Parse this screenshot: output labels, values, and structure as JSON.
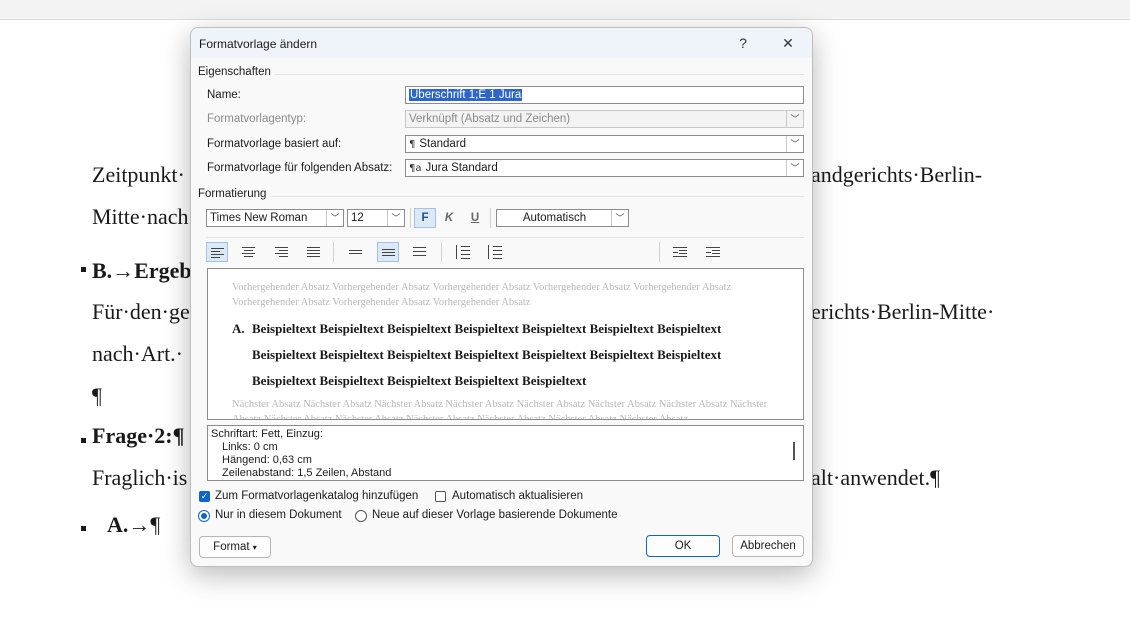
{
  "document": {
    "line1": "Zeitpunkt·",
    "line1_right": "andgerichts·Berlin-",
    "line2": "Mitte·nach",
    "heading_b": "B.→Ergeb",
    "line4": "Für·den·ge",
    "line4_right": "erichts·Berlin-Mitte·",
    "line5": "nach·Art.·",
    "pilcrow": "¶",
    "heading_frage": "Frage·2:¶",
    "line8": "Fraglich·is",
    "line8_right": "alt·anwendet.¶",
    "item_a": "A.→",
    "item_a_pilcrow": "¶"
  },
  "dialog": {
    "title": "Formatvorlage ändern",
    "help": "?",
    "close": "✕",
    "properties_group": "Eigenschaften",
    "name_label": "Name:",
    "name_value": "Überschrift 1;E 1 Jura",
    "type_label": "Formatvorlagentyp:",
    "type_value": "Verknüpft (Absatz und Zeichen)",
    "based_label": "Formatvorlage basiert auf:",
    "based_glyph": "¶",
    "based_value": "Standard",
    "next_label": "Formatvorlage für folgenden Absatz:",
    "next_glyph": "¶a",
    "next_value": "Jura Standard",
    "formatting_group": "Formatierung",
    "font": "Times New Roman",
    "size": "12",
    "bold": "F",
    "italic": "K",
    "underline": "U",
    "color": "Automatisch",
    "preview": {
      "previous": "Vorhergehender Absatz Vorhergehender Absatz Vorhergehender Absatz Vorhergehender Absatz Vorhergehender Absatz Vorhergehender Absatz Vorhergehender Absatz Vorhergehender Absatz",
      "number": "A.",
      "line1": "Beispieltext Beispieltext Beispieltext Beispieltext Beispieltext Beispieltext Beispieltext",
      "line2": "Beispieltext Beispieltext Beispieltext Beispieltext Beispieltext Beispieltext Beispieltext",
      "line3": "Beispieltext Beispieltext Beispieltext Beispieltext Beispieltext",
      "next": "Nächster Absatz Nächster Absatz Nächster Absatz Nächster Absatz Nächster Absatz Nächster Absatz Nächster Absatz Nächster Absatz Nächster Absatz Nächster Absatz Nächster Absatz Nächster Absatz Nächster Absatz Nächster Absatz"
    },
    "description": [
      "Schriftart: Fett, Einzug:",
      "Links:  0 cm",
      "Hängend:  0,63 cm",
      "Zeilenabstand:  1,5 Zeilen, Abstand"
    ],
    "add_to_gallery": "Zum Formatvorlagenkatalog hinzufügen",
    "add_to_gallery_checked": true,
    "auto_update": "Automatisch aktualisieren",
    "auto_update_checked": false,
    "only_this_doc": "Nur in diesem Dokument",
    "new_docs": "Neue auf dieser Vorlage basierende Dokumente",
    "format_button": "Format",
    "ok_button": "OK",
    "cancel_button": "Abbrechen"
  }
}
